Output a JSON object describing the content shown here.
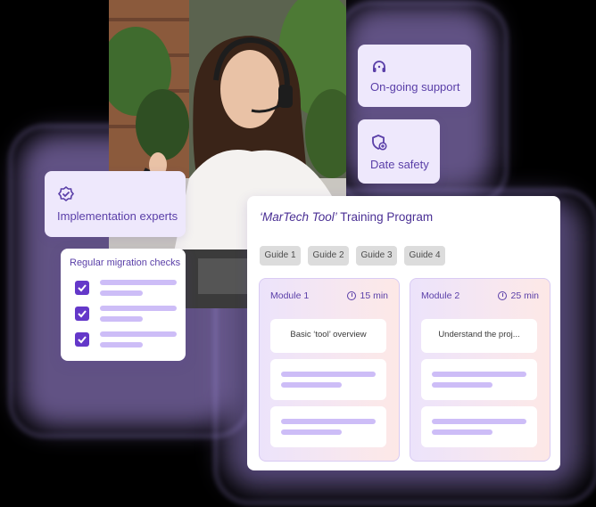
{
  "features": {
    "support": {
      "label": "On-going support",
      "icon": "headset-icon"
    },
    "safety": {
      "label": "Date safety",
      "icon": "shield-icon"
    },
    "experts": {
      "label": "Implementation experts",
      "icon": "badge-icon"
    }
  },
  "checklist": {
    "title": "Regular migration checks",
    "items": [
      {
        "checked": true
      },
      {
        "checked": true
      },
      {
        "checked": true
      }
    ]
  },
  "program": {
    "title_italic": "‘MarTech Tool’",
    "title_rest": " Training Program",
    "tabs": [
      "Guide 1",
      "Guide 2",
      "Guide 3",
      "Guide 4"
    ],
    "modules": [
      {
        "name": "Module 1",
        "time": "15 min",
        "first_item": "Basic ‘tool’ overview"
      },
      {
        "name": "Module 2",
        "time": "25 min",
        "first_item": "Understand the proj..."
      }
    ]
  },
  "colors": {
    "accent": "#6438c9",
    "text_purple": "#5a3fa8",
    "card_lavender": "#eee8fc",
    "bar": "#cdbdf7"
  }
}
